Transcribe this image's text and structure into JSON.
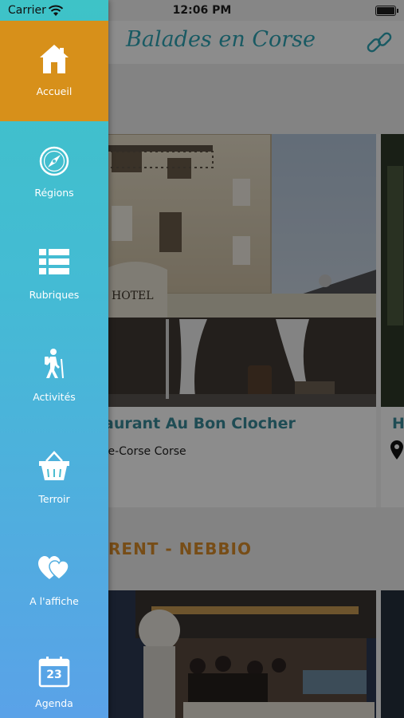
{
  "status_bar": {
    "carrier": "Carrier",
    "time": "12:06 PM"
  },
  "header": {
    "title": "Balades en Corse"
  },
  "cards": [
    {
      "title": "aurant Au Bon Clocher",
      "location": "te-Corse Corse",
      "photo_caption": "HOTEL"
    },
    {
      "title": "H"
    }
  ],
  "section_heading": "RENT - NEBBIO",
  "menu": [
    {
      "label": "Accueil",
      "icon": "home-icon",
      "active": true
    },
    {
      "label": "Régions",
      "icon": "compass-icon",
      "active": false
    },
    {
      "label": "Rubriques",
      "icon": "list-icon",
      "active": false
    },
    {
      "label": "Activités",
      "icon": "hiker-icon",
      "active": false
    },
    {
      "label": "Terroir",
      "icon": "basket-icon",
      "active": false
    },
    {
      "label": "A l'affiche",
      "icon": "hearts-icon",
      "active": false
    },
    {
      "label": "Agenda",
      "icon": "calendar-icon",
      "active": false,
      "day": "23"
    }
  ],
  "colors": {
    "accent": "#d7901a",
    "drawer_top": "#3ec3c7",
    "drawer_bottom": "#5aa2e8",
    "title": "#2fa5b5",
    "card_title": "#3a8a9a",
    "section": "#d98d2a"
  }
}
